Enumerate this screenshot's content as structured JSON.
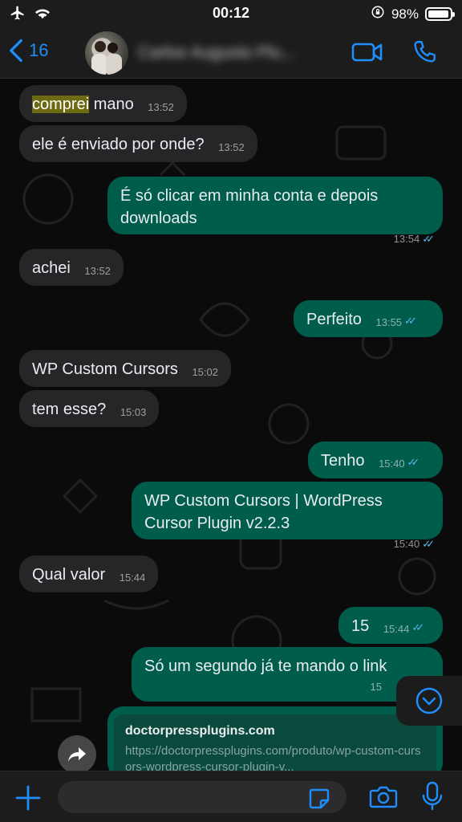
{
  "status_bar": {
    "time": "00:12",
    "battery_pct": "98%",
    "battery_level": 0.98
  },
  "header": {
    "back_count": "16",
    "contact_name": "Carlos Augusto Plu..."
  },
  "messages": [
    {
      "dir": "in",
      "text_highlight": "comprei",
      "text": " mano",
      "time": "13:52"
    },
    {
      "dir": "in",
      "text": "ele é enviado por onde?",
      "time": "13:52"
    },
    {
      "dir": "out",
      "text": "É só clicar em minha conta e depois downloads",
      "time": "13:54"
    },
    {
      "dir": "in",
      "text": "achei",
      "time": "13:52"
    },
    {
      "dir": "out",
      "text": "Perfeito",
      "time": "13:55"
    },
    {
      "dir": "in",
      "text": "WP Custom Cursors",
      "time": "15:02"
    },
    {
      "dir": "in",
      "text": "tem esse?",
      "time": "15:03"
    },
    {
      "dir": "out",
      "text": "Tenho",
      "time": "15:40"
    },
    {
      "dir": "out",
      "text": "WP Custom Cursors | WordPress Cursor Plugin v2.2.3",
      "time": "15:40"
    },
    {
      "dir": "in",
      "text": "Qual valor",
      "time": "15:44"
    },
    {
      "dir": "out",
      "text": "15",
      "time": "15:44"
    },
    {
      "dir": "out",
      "text": "Só um segundo já te mando o link",
      "time": "15"
    }
  ],
  "link_preview": {
    "domain": "doctorpressplugins.com",
    "url": "https://doctorpressplugins.com/produto/wp-custom-cursors-wordpress-cursor-plugin-v..."
  },
  "input": {
    "value": ""
  },
  "colors": {
    "accent": "#1f8efa",
    "outgoing": "#005c4b",
    "incoming": "#262628",
    "read_ticks": "#53bdeb"
  }
}
